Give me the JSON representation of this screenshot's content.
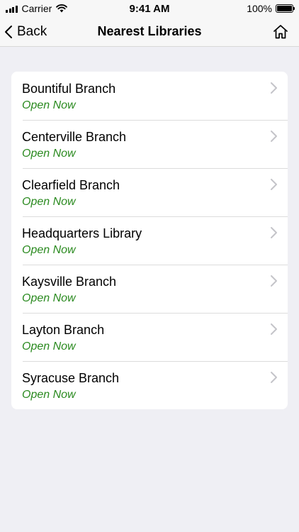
{
  "status_bar": {
    "carrier": "Carrier",
    "time": "9:41 AM",
    "battery": "100%",
    "icons": [
      "signal-icon",
      "wifi-icon",
      "battery-icon"
    ]
  },
  "nav": {
    "back_label": "Back",
    "title": "Nearest Libraries",
    "icons": [
      "chevron-left-icon",
      "home-icon"
    ]
  },
  "colors": {
    "open_status": "#2a8a1f",
    "background": "#efeff4"
  },
  "libraries": [
    {
      "name": "Bountiful Branch",
      "status": "Open Now"
    },
    {
      "name": "Centerville Branch",
      "status": "Open Now"
    },
    {
      "name": "Clearfield Branch",
      "status": "Open Now"
    },
    {
      "name": "Headquarters Library",
      "status": "Open Now"
    },
    {
      "name": "Kaysville Branch",
      "status": "Open Now"
    },
    {
      "name": "Layton Branch",
      "status": "Open Now"
    },
    {
      "name": "Syracuse Branch",
      "status": "Open Now"
    }
  ]
}
